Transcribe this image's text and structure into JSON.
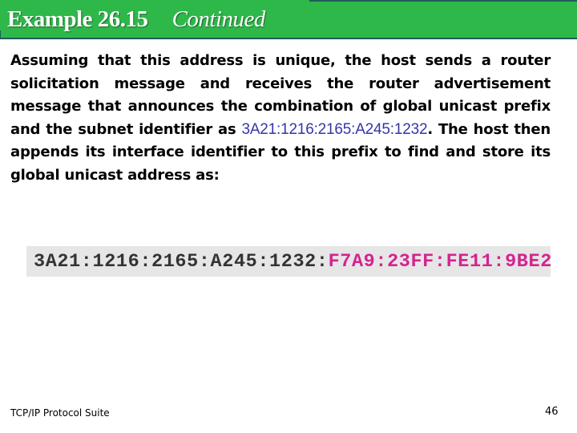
{
  "header": {
    "example_label": "Example 26.15",
    "continued_label": "Continued",
    "background_color": "#2eb84a"
  },
  "body": {
    "text_before_prefix": "Assuming that this address is unique, the host sends a router solicitation message and receives the router advertisement message that announces the combination of global unicast prefix and the subnet identifier as ",
    "prefix_highlight": "3A21:1216:2165:A245:1232",
    "text_after_prefix": ". The host then appends its interface identifier to this prefix to find and store its global unicast address as:",
    "prefix_color": "#3636a8"
  },
  "address": {
    "prefix_part": "3A21:1216:2165:A245:1232",
    "separator": ":",
    "interface_id_part": "F7A9:23FF:FE11:9BE2",
    "prefix_color": "#333333",
    "interface_id_color": "#d4238f"
  },
  "footer": {
    "book_title": "TCP/IP Protocol Suite",
    "page_number": "46"
  }
}
